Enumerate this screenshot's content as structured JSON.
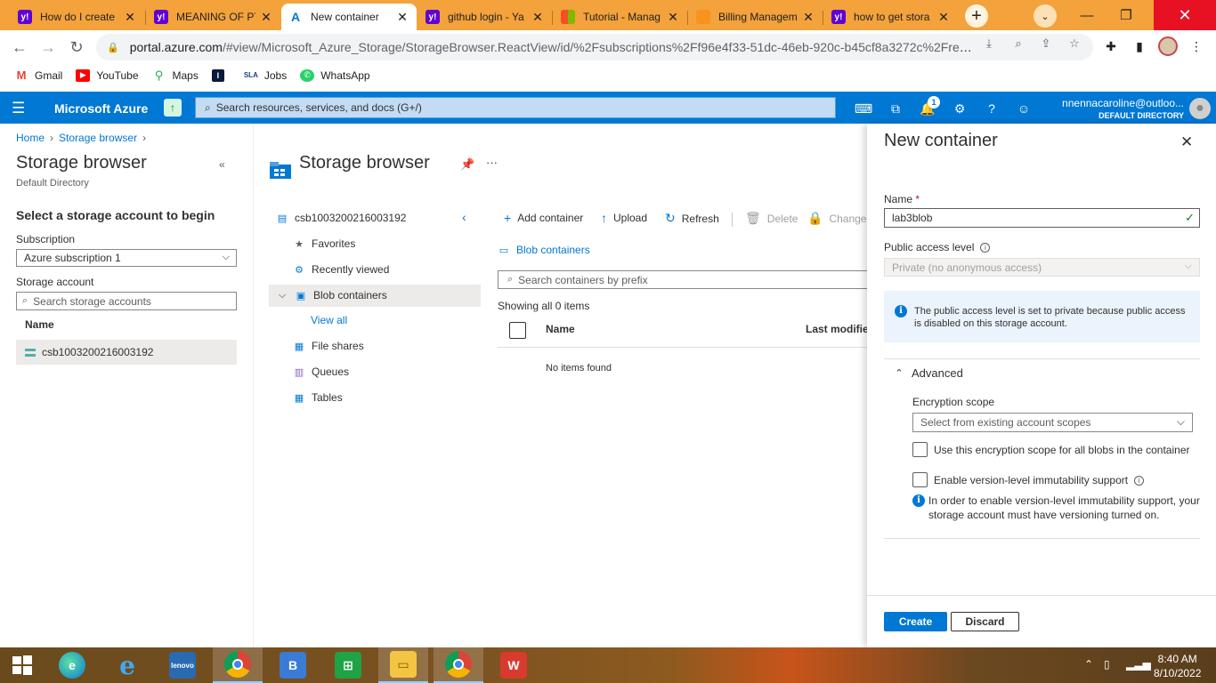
{
  "browser": {
    "tabs": [
      {
        "title": "How do I create",
        "favicon": "yahoo-icon",
        "color": "#6001d2"
      },
      {
        "title": "MEANING OF PT",
        "favicon": "yahoo-icon",
        "color": "#6001d2"
      },
      {
        "title": "New container",
        "favicon": "azure-icon",
        "color": "#0078d4"
      },
      {
        "title": "github login - Ya",
        "favicon": "yahoo-icon",
        "color": "#6001d2"
      },
      {
        "title": "Tutorial - Manag",
        "favicon": "microsoft-icon",
        "color": "#f25022"
      },
      {
        "title": "Billing Managem",
        "favicon": "box-icon",
        "color": "#f7931e"
      },
      {
        "title": "how to get stora",
        "favicon": "yahoo-icon",
        "color": "#6001d2"
      }
    ],
    "url_host": "portal.azure.com",
    "url_path": "/#view/Microsoft_Azure_Storage/StorageBrowser.ReactView/id/%2Fsubscriptions%2Ff96e4f33-51dc-46eb-920c-b45cf8a3272c%2Fresou...",
    "bookmarks": [
      {
        "label": "Gmail",
        "icon": "gmail-icon"
      },
      {
        "label": "YouTube",
        "icon": "youtube-icon"
      },
      {
        "label": "Maps",
        "icon": "maps-icon"
      },
      {
        "label": "",
        "icon": "bookmark-icon"
      },
      {
        "label": "Jobs",
        "icon": "jobs-icon"
      },
      {
        "label": "WhatsApp",
        "icon": "whatsapp-icon"
      }
    ]
  },
  "azure": {
    "brand": "Microsoft Azure",
    "search_placeholder": "Search resources, services, and docs (G+/)",
    "notification_count": "1",
    "user_email": "nnennacaroline@outloo...",
    "user_directory": "DEFAULT DIRECTORY"
  },
  "breadcrumb": [
    "Home",
    "Storage browser"
  ],
  "left_blade": {
    "title": "Storage browser",
    "subtitle": "Default Directory",
    "heading": "Select a storage account to begin",
    "subscription_label": "Subscription",
    "subscription_value": "Azure subscription 1",
    "account_label": "Storage account",
    "account_search_placeholder": "Search storage accounts",
    "name_header": "Name",
    "accounts": [
      "csb1003200216003192"
    ]
  },
  "main_blade": {
    "title": "Storage browser",
    "account": "csb1003200216003192",
    "tree": [
      "Favorites",
      "Recently viewed",
      "Blob containers",
      "View all",
      "File shares",
      "Queues",
      "Tables"
    ],
    "commands": [
      "Add container",
      "Upload",
      "Refresh",
      "Delete",
      "Change a"
    ],
    "section": "Blob containers",
    "search_placeholder": "Search containers by prefix",
    "count_text": "Showing all 0 items",
    "columns": [
      "Name",
      "Last modified"
    ],
    "empty_text": "No items found"
  },
  "pane": {
    "title": "New container",
    "name_label": "Name",
    "required_mark": "*",
    "name_value": "lab3blob",
    "access_label": "Public access level",
    "access_value": "Private (no anonymous access)",
    "info_text": "The public access level is set to private because public access is disabled on this storage account.",
    "advanced_label": "Advanced",
    "encryption_label": "Encryption scope",
    "encryption_placeholder": "Select from existing account scopes",
    "checkbox1_label": "Use this encryption scope for all blobs in the container",
    "checkbox2_label": "Enable version-level immutability support",
    "immut_info": "In order to enable version-level immutability support, your storage account must have versioning turned on.",
    "create_label": "Create",
    "discard_label": "Discard"
  },
  "taskbar": {
    "time": "8:40 AM",
    "date": "8/10/2022"
  }
}
